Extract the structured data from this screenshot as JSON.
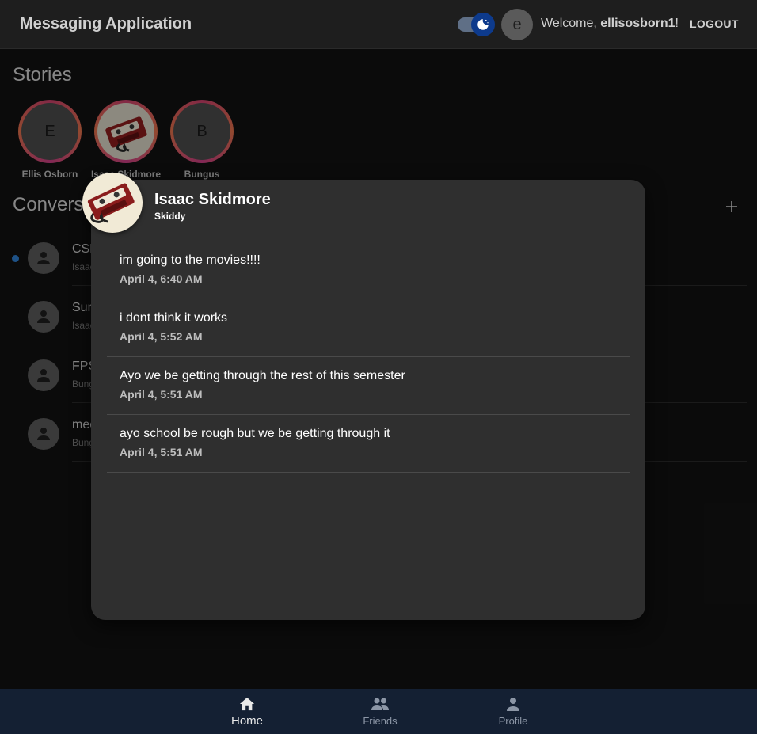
{
  "header": {
    "title": "Messaging Application",
    "avatar_letter": "e",
    "welcome_prefix": "Welcome, ",
    "username": "ellisosborn1",
    "welcome_suffix": "!",
    "logout_label": "LOGOUT",
    "theme_toggle_icon": "dark-mode-icon",
    "theme_mode": "dark"
  },
  "stories": {
    "title": "Stories",
    "items": [
      {
        "initial": "E",
        "name": "Ellis Osborn"
      },
      {
        "initial": "",
        "name": "Isaac Skidmore"
      },
      {
        "initial": "B",
        "name": "Bungus"
      }
    ]
  },
  "conversations": {
    "title": "Conversations",
    "add_icon": "+",
    "items": [
      {
        "name": "CSE",
        "sub": "Isaac",
        "unread": true
      },
      {
        "name": "Sur",
        "sub": "Isaac",
        "unread": false
      },
      {
        "name": "FPS",
        "sub": "Bung",
        "unread": false
      },
      {
        "name": "mee",
        "sub": "Bung",
        "unread": false
      }
    ]
  },
  "story_modal": {
    "name": "Isaac Skidmore",
    "handle": "Skiddy",
    "messages": [
      {
        "text": "im going to the movies!!!!",
        "time": "April 4, 6:40 AM"
      },
      {
        "text": "i dont think it works",
        "time": "April 4, 5:52 AM"
      },
      {
        "text": "Ayo we be getting through the rest of this semester",
        "time": "April 4, 5:51 AM"
      },
      {
        "text": "ayo school be rough but we be getting through it",
        "time": "April 4, 5:51 AM"
      }
    ]
  },
  "bottom_nav": {
    "items": [
      {
        "label": "Home",
        "icon": "home-icon",
        "active": true
      },
      {
        "label": "Friends",
        "icon": "friends-icon",
        "active": false
      },
      {
        "label": "Profile",
        "icon": "profile-icon",
        "active": false
      }
    ]
  },
  "colors": {
    "background": "#121212",
    "appbar": "#1e1e1e",
    "modal": "#2f2f2f",
    "bottom_nav": "#142033",
    "story_ring": "#c9406b",
    "unread_dot": "#2f7fd0"
  }
}
